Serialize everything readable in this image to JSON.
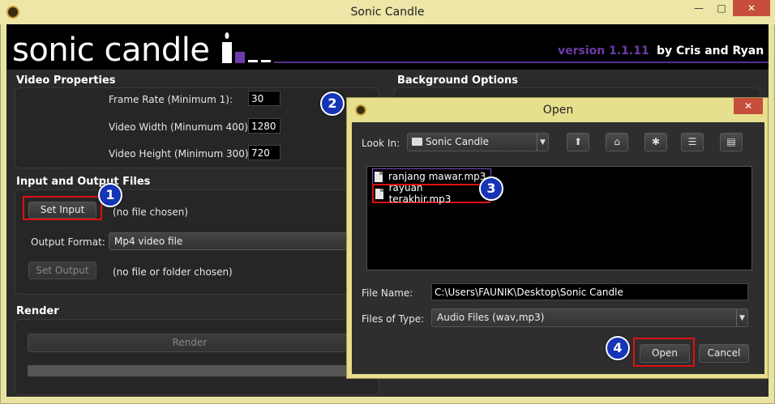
{
  "window": {
    "title": "Sonic Candle",
    "minimize": "—",
    "maximize": "□",
    "close": "✕"
  },
  "header": {
    "logo": "sonic candle",
    "version": "version 1.1.11",
    "byline": "by Cris and Ryan",
    "accent_color": "#6d3aa8"
  },
  "video_properties": {
    "title": "Video Properties",
    "frame_rate_label": "Frame Rate (Minimum 1):",
    "frame_rate_value": "30",
    "width_label": "Video Width (Minumum 400):",
    "width_value": "1280",
    "height_label": "Video Height (Minimum 300):",
    "height_value": "720"
  },
  "background_options": {
    "title": "Background Options"
  },
  "io_files": {
    "title": "Input and Output Files",
    "set_input_label": "Set Input",
    "input_status": "(no file chosen)",
    "output_format_label": "Output Format:",
    "output_format_value": "Mp4 video file",
    "set_output_label": "Set Output",
    "output_status": "(no file or folder chosen)"
  },
  "render": {
    "title": "Render",
    "render_label": "Render"
  },
  "open_dialog": {
    "title": "Open",
    "close": "✕",
    "look_in_label": "Look In:",
    "look_in_value": "Sonic Candle",
    "files": [
      {
        "name": "ranjang mawar.mp3"
      },
      {
        "name": "rayuan terakhir.mp3"
      }
    ],
    "file_name_label": "File Name:",
    "file_name_value": "C:\\Users\\FAUNIK\\Desktop\\Sonic Candle",
    "files_of_type_label": "Files of Type:",
    "files_of_type_value": "Audio Files (wav,mp3)",
    "open_label": "Open",
    "cancel_label": "Cancel",
    "toolbar_icons": [
      "up-folder-icon",
      "home-icon",
      "new-folder-icon",
      "list-view-icon",
      "details-view-icon"
    ]
  },
  "steps": [
    "1",
    "2",
    "3",
    "4"
  ],
  "highlight_color": "#e01010",
  "badge_color": "#1535b5"
}
